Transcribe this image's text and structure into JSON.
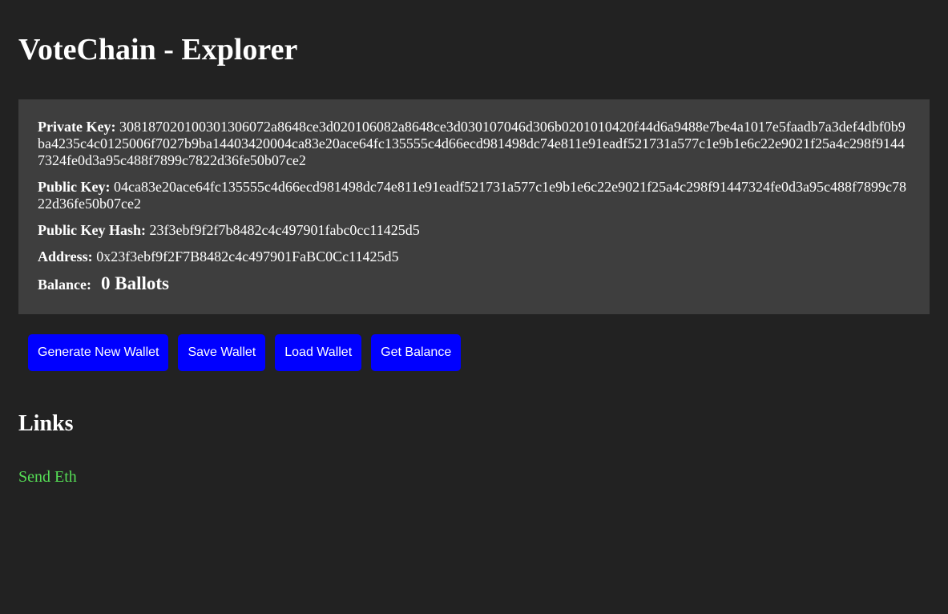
{
  "header": {
    "title": "VoteChain - Explorer"
  },
  "wallet": {
    "private_key_label": "Private Key:",
    "private_key_value": "308187020100301306072a8648ce3d020106082a8648ce3d030107046d306b0201010420f44d6a9488e7be4a1017e5faadb7a3def4dbf0b9ba4235c4c0125006f7027b9ba14403420004ca83e20ace64fc135555c4d66ecd981498dc74e811e91eadf521731a577c1e9b1e6c22e9021f25a4c298f91447324fe0d3a95c488f7899c7822d36fe50b07ce2",
    "public_key_label": "Public Key:",
    "public_key_value": "04ca83e20ace64fc135555c4d66ecd981498dc74e811e91eadf521731a577c1e9b1e6c22e9021f25a4c298f91447324fe0d3a95c488f7899c7822d36fe50b07ce2",
    "public_key_hash_label": "Public Key Hash:",
    "public_key_hash_value": "23f3ebf9f2f7b8482c4c497901fabc0cc11425d5",
    "address_label": "Address:",
    "address_value": "0x23f3ebf9f2F7B8482c4c497901FaBC0Cc11425d5",
    "balance_label": "Balance:",
    "balance_value": "0 Ballots"
  },
  "actions": {
    "generate_label": "Generate New Wallet",
    "save_label": "Save Wallet",
    "load_label": "Load Wallet",
    "balance_label": "Get Balance"
  },
  "links": {
    "heading": "Links",
    "items": [
      {
        "label": "Send Eth"
      }
    ]
  },
  "colors": {
    "background": "#222222",
    "panel": "#3e3e3e",
    "button": "#0000ff",
    "link": "#55dd55"
  }
}
